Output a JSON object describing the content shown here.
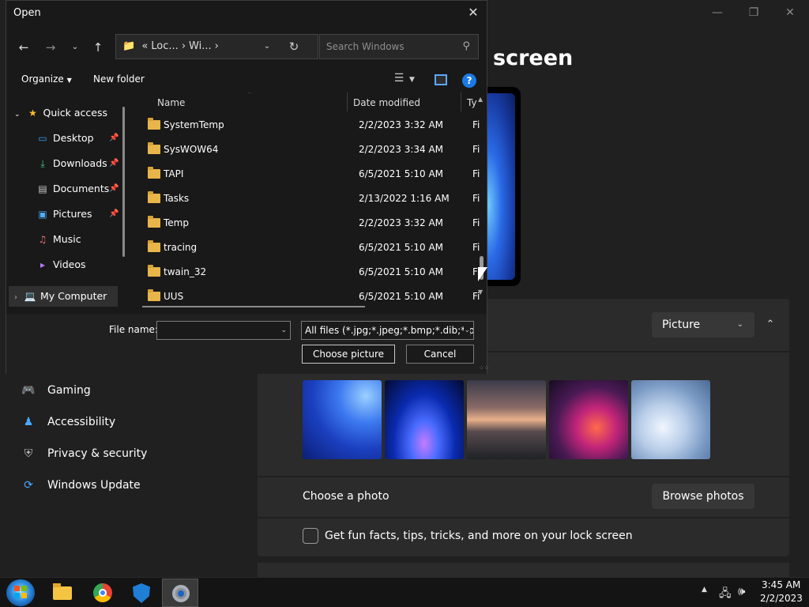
{
  "settings": {
    "page_title": "screen",
    "picture_select": "Picture",
    "choose_photo_label": "Choose a photo",
    "browse_label": "Browse photos",
    "funfacts_label": "Get fun facts, tips, tricks, and more on your lock screen",
    "nav": [
      {
        "label": "Gaming",
        "icon": "gamepad-icon"
      },
      {
        "label": "Accessibility",
        "icon": "accessibility-icon"
      },
      {
        "label": "Privacy & security",
        "icon": "shield-icon"
      },
      {
        "label": "Windows Update",
        "icon": "update-icon"
      }
    ]
  },
  "dialog": {
    "title": "Open",
    "address": {
      "overflow": "«",
      "seg1": "Loc...",
      "sep": "›",
      "seg2": "Wi...",
      "sep2": "›"
    },
    "search_placeholder": "Search Windows",
    "toolbar": {
      "organize": "Organize",
      "new_folder": "New folder"
    },
    "nav_tree": [
      {
        "label": "Quick access",
        "icon": "star-icon"
      },
      {
        "label": "Desktop",
        "icon": "desktop-icon",
        "pinned": true
      },
      {
        "label": "Downloads",
        "icon": "download-icon",
        "pinned": true
      },
      {
        "label": "Documents",
        "icon": "document-icon",
        "pinned": true
      },
      {
        "label": "Pictures",
        "icon": "pictures-icon",
        "pinned": true
      },
      {
        "label": "Music",
        "icon": "music-icon"
      },
      {
        "label": "Videos",
        "icon": "video-icon"
      },
      {
        "label": "My Computer",
        "icon": "computer-icon"
      }
    ],
    "columns": {
      "name": "Name",
      "date": "Date modified",
      "type": "Ty"
    },
    "files": [
      {
        "name": "SystemTemp",
        "date": "2/2/2023 3:32 AM",
        "type": "Fi"
      },
      {
        "name": "SysWOW64",
        "date": "2/2/2023 3:34 AM",
        "type": "Fi"
      },
      {
        "name": "TAPI",
        "date": "6/5/2021 5:10 AM",
        "type": "Fi"
      },
      {
        "name": "Tasks",
        "date": "2/13/2022 1:16 AM",
        "type": "Fi"
      },
      {
        "name": "Temp",
        "date": "2/2/2023 3:32 AM",
        "type": "Fi"
      },
      {
        "name": "tracing",
        "date": "6/5/2021 5:10 AM",
        "type": "Fi"
      },
      {
        "name": "twain_32",
        "date": "6/5/2021 5:10 AM",
        "type": "Fi"
      },
      {
        "name": "UUS",
        "date": "6/5/2021 5:10 AM",
        "type": "Fi"
      }
    ],
    "file_name_label": "File name:",
    "file_name_value": "",
    "filter": "All files (*.jpg;*.jpeg;*.bmp;*.dib;*.png",
    "choose_label": "Choose picture",
    "cancel_label": "Cancel"
  },
  "taskbar": {
    "time": "3:45 AM",
    "date": "2/2/2023"
  }
}
